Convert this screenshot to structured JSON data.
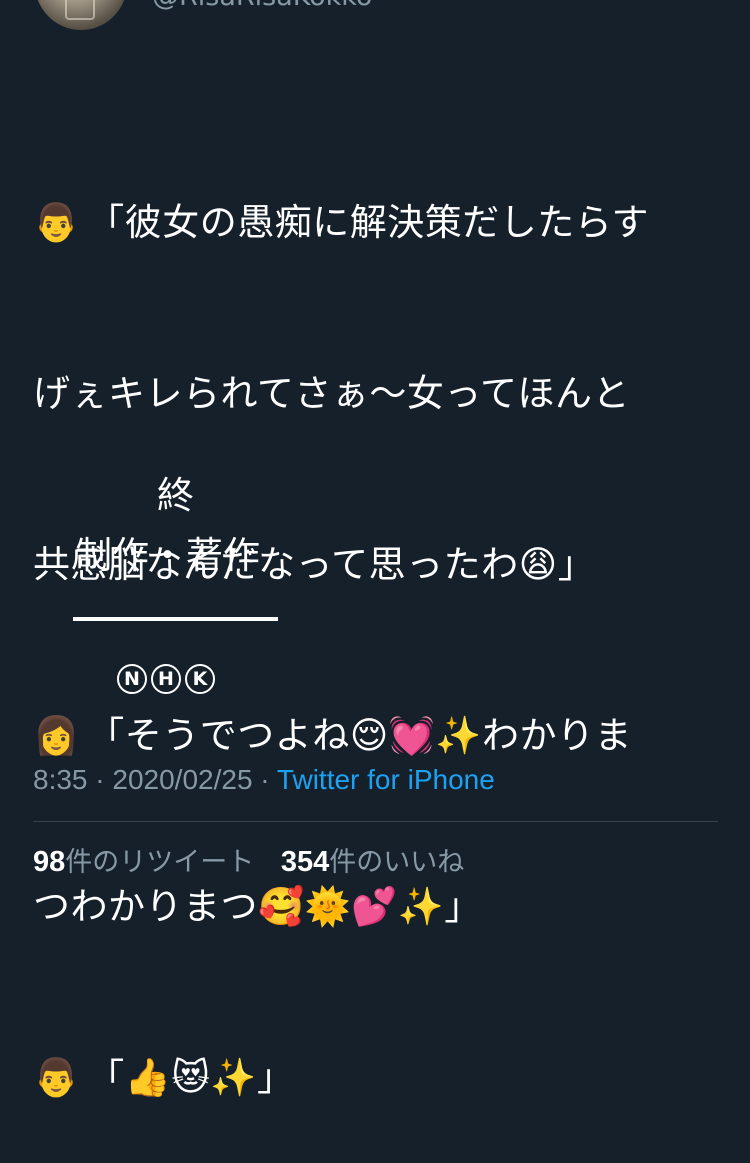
{
  "author": {
    "handle": "@RisaRisaKokko"
  },
  "tweet": {
    "lines": [
      {
        "speaker_icon": "👨",
        "text": "「彼女の愚痴に解決策だしたらす"
      },
      {
        "text": "げぇキレられてさぁ〜女ってほんと"
      },
      {
        "text": "共感脳なんだなって思ったわ😩」"
      },
      {
        "speaker_icon": "👩",
        "text": "「そうでつよね😌💓✨わかりま"
      },
      {
        "text": "つわかりまつ🥰🌞💕✨」"
      },
      {
        "speaker_icon": "👨",
        "text": "「👍😻✨」"
      }
    ],
    "credits": {
      "fin": "終",
      "production": "制作・著作",
      "nhk": [
        "N",
        "H",
        "K"
      ]
    }
  },
  "meta": {
    "time": "8:35",
    "separator": " · ",
    "date": "2020/02/25",
    "source": "Twitter for iPhone"
  },
  "stats": {
    "retweets_count": "98",
    "retweets_label": "件のリツイート",
    "likes_count": "354",
    "likes_label": "件のいいね"
  },
  "colors": {
    "background": "#15202b",
    "text": "#ffffff",
    "secondary_text": "#8899a6",
    "link": "#1da1f2",
    "divider": "#38444d"
  }
}
